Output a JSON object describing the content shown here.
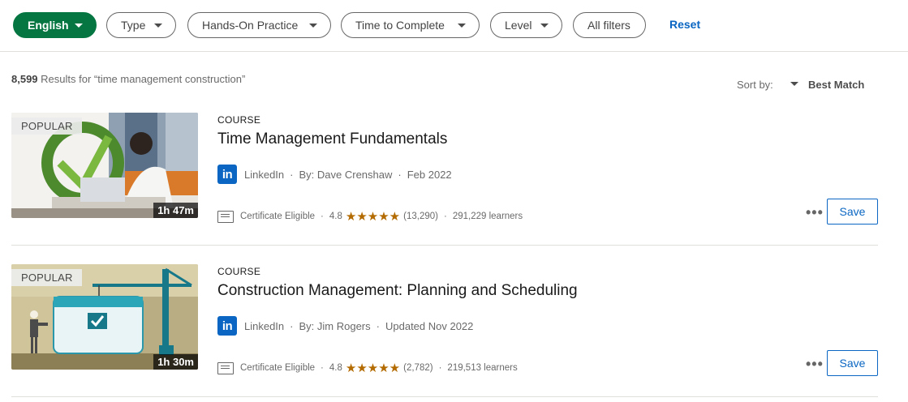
{
  "filters": {
    "language": "English",
    "type": "Type",
    "hands_on": "Hands-On Practice",
    "time": "Time to Complete",
    "level": "Level",
    "all": "All filters",
    "reset": "Reset",
    "active_color": "#057642"
  },
  "results": {
    "count": "8,599",
    "text": " Results for “time management construction”",
    "sort_label": "Sort by:",
    "sort_value": "Best Match"
  },
  "courses": [
    {
      "badge": "POPULAR",
      "duration": "1h 47m",
      "type": "COURSE",
      "title": "Time Management Fundamentals",
      "provider": "LinkedIn",
      "author": "By: Dave Crenshaw",
      "date": "Feb 2022",
      "certificate": "Certificate Eligible",
      "rating": "4.8",
      "stars": "★★★★★",
      "reviews": "(13,290)",
      "learners": "291,229 learners",
      "more": "•••",
      "save": "Save"
    },
    {
      "badge": "POPULAR",
      "duration": "1h 30m",
      "type": "COURSE",
      "title": "Construction Management: Planning and Scheduling",
      "provider": "LinkedIn",
      "author": "By: Jim Rogers",
      "date": "Updated Nov 2022",
      "certificate": "Certificate Eligible",
      "rating": "4.8",
      "stars": "★★★★★",
      "reviews": "(2,782)",
      "learners": "219,513 learners",
      "more": "•••",
      "save": "Save"
    }
  ],
  "icons": {
    "linkedin": "in"
  }
}
